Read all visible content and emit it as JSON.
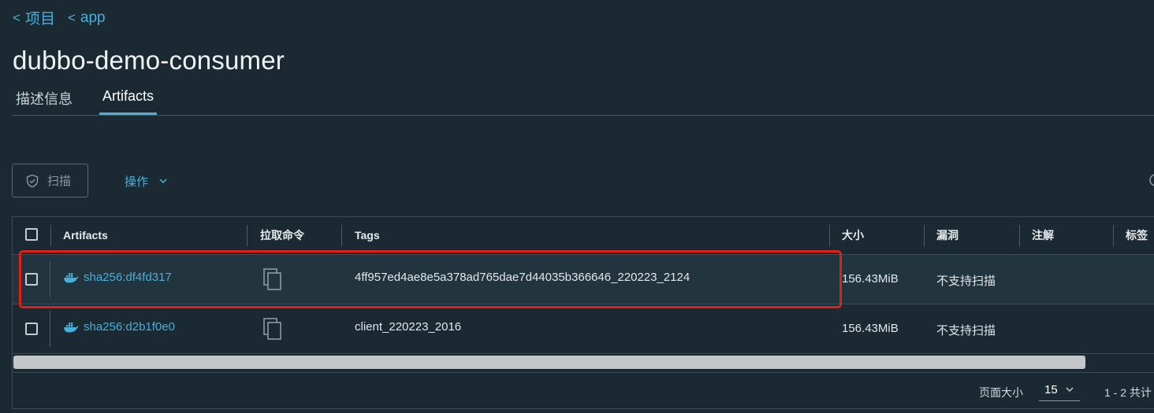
{
  "breadcrumb": {
    "items": [
      {
        "label": "项目"
      },
      {
        "label": "app"
      }
    ]
  },
  "title": "dubbo-demo-consumer",
  "tabs": [
    {
      "label": "描述信息",
      "active": false
    },
    {
      "label": "Artifacts",
      "active": true
    }
  ],
  "toolbar": {
    "scan_label": "扫描",
    "actions_label": "操作"
  },
  "table": {
    "columns": [
      "Artifacts",
      "拉取命令",
      "Tags",
      "大小",
      "漏洞",
      "注解",
      "标签"
    ],
    "rows": [
      {
        "artifact": "sha256:df4fd317",
        "tags": "4ff957ed4ae8e5a378ad765dae7d44035b366646_220223_2124",
        "size": "156.43MiB",
        "vulnerabilities": "不支持扫描",
        "annotations": "",
        "labels": ""
      },
      {
        "artifact": "sha256:d2b1f0e0",
        "tags": "client_220223_2016",
        "size": "156.43MiB",
        "vulnerabilities": "不支持扫描",
        "annotations": "",
        "labels": ""
      }
    ]
  },
  "pagination": {
    "page_size_label": "页面大小",
    "page_size": "15",
    "range_text": "1 - 2 共计"
  },
  "colors": {
    "background": "#1b2a32",
    "accent": "#49afd9",
    "highlight": "#e0201a"
  },
  "icons": [
    "chevron-left-icon",
    "shield-icon",
    "chevron-down-icon",
    "docker-icon",
    "copy-icon"
  ]
}
